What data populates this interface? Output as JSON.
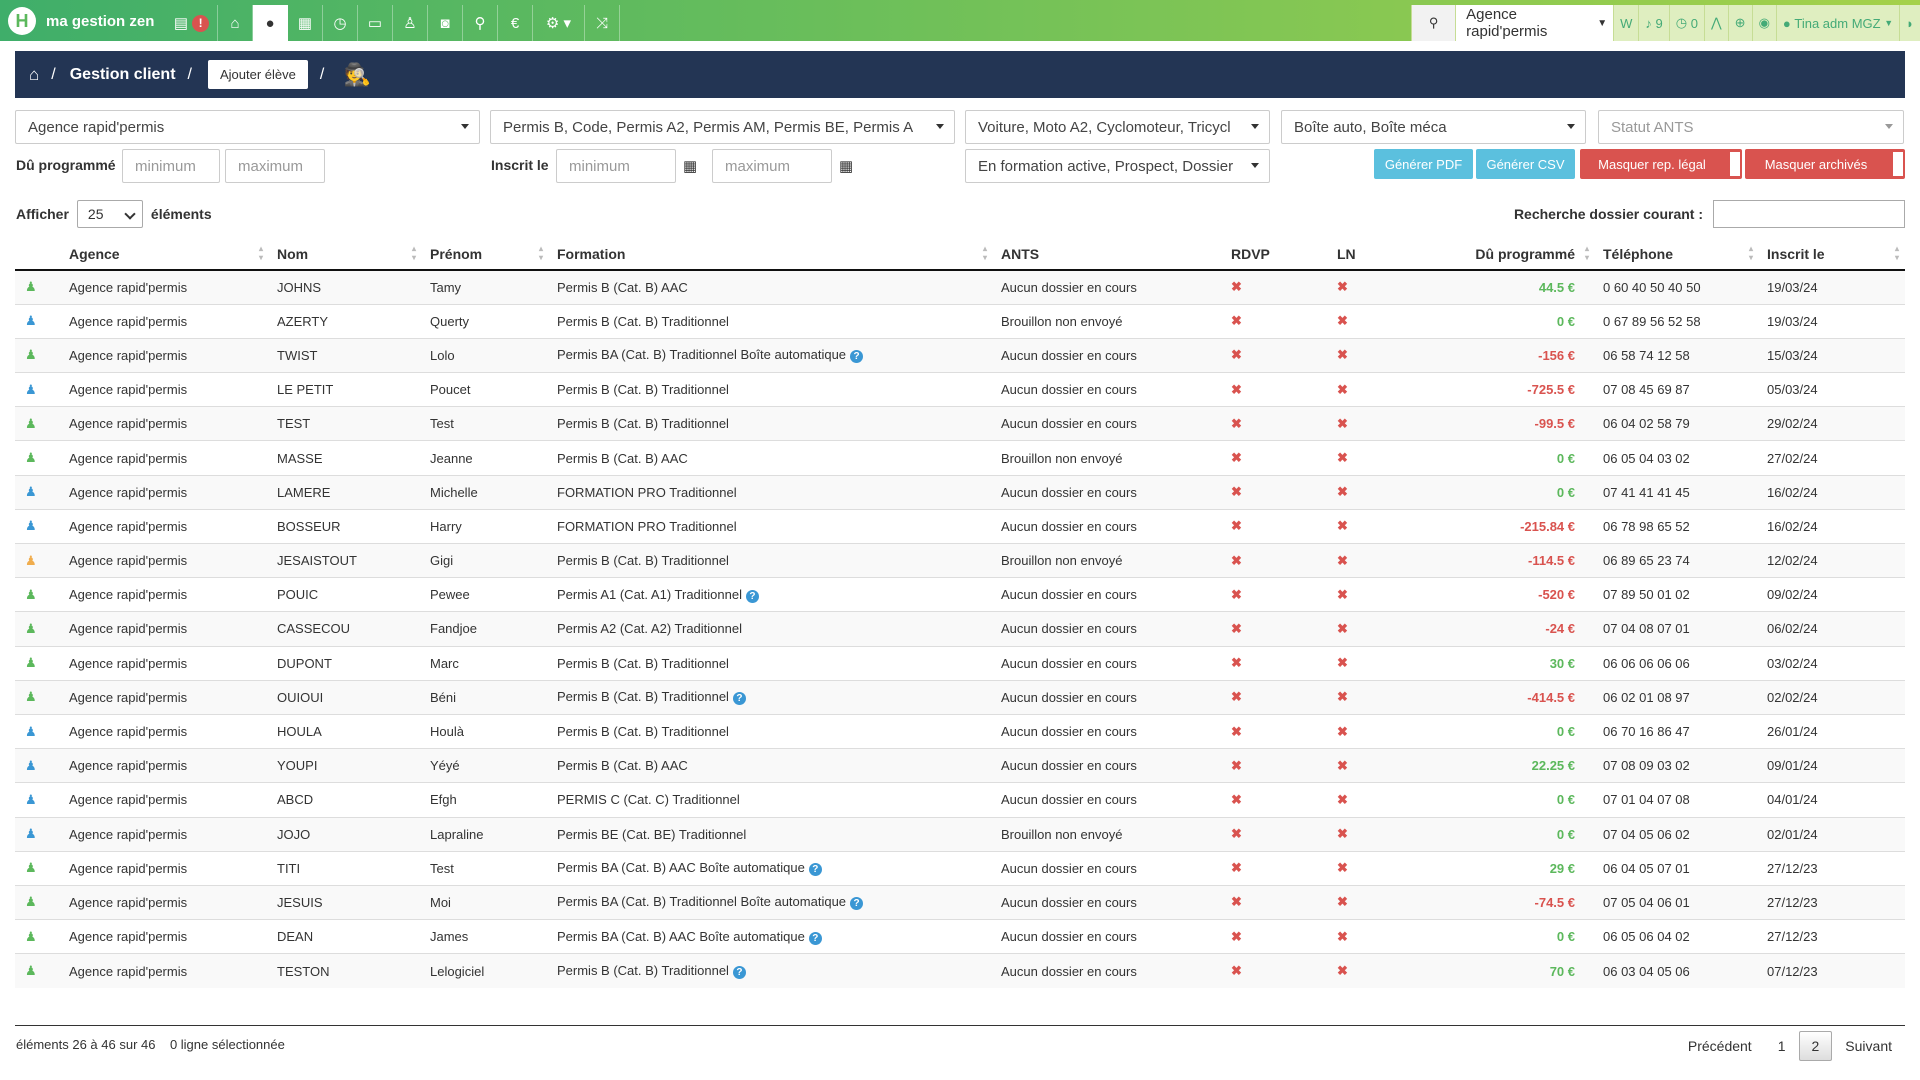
{
  "brand": {
    "name": "ma gestion zen",
    "logo_letter": "H"
  },
  "nav": {
    "alert_badge": "!",
    "icons": [
      "id-card-icon",
      "home-icon",
      "user-icon",
      "calendar-icon",
      "clock-icon",
      "credit-card-icon",
      "person-icon",
      "car-icon",
      "map-marker-icon",
      "euro-icon",
      "cogs-icon",
      "random-icon"
    ]
  },
  "topright": {
    "agency": "Agence rapid'permis",
    "w_label": "W",
    "bell_count": "9",
    "circle_count": "0",
    "user": "Tina adm MGZ"
  },
  "header": {
    "title": "Gestion client",
    "add_button": "Ajouter élève"
  },
  "filters": {
    "agency": "Agence rapid'permis",
    "permits": "Permis B, Code, Permis A2, Permis AM, Permis BE, Permis A",
    "vehicles": "Voiture, Moto A2, Cyclomoteur, Tricycl",
    "gearbox": "Boîte auto, Boîte méca",
    "ants_placeholder": "Statut ANTS",
    "status": "En formation active, Prospect, Dossier",
    "due_label": "Dû programmé",
    "registered_label": "Inscrit le",
    "min_placeholder": "minimum",
    "max_placeholder": "maximum"
  },
  "buttons": {
    "pdf": "Générer PDF",
    "csv": "Générer CSV",
    "hide_legal": "Masquer rep. légal",
    "hide_archived": "Masquer archivés"
  },
  "table_controls": {
    "show_label": "Afficher",
    "page_size": "25",
    "elements_label": "éléments",
    "search_label": "Recherche dossier courant :"
  },
  "columns": [
    "Agence",
    "Nom",
    "Prénom",
    "Formation",
    "ANTS",
    "RDVP",
    "LN",
    "Dû programmé",
    "Téléphone",
    "Inscrit le"
  ],
  "rows": [
    {
      "c": "#5cb85c",
      "agence": "Agence rapid'permis",
      "nom": "JOHNS",
      "prenom": "Tamy",
      "formation": "Permis B (Cat. B) AAC",
      "q": false,
      "ants": "Aucun dossier en cours",
      "rdvp": "✖",
      "ln": "✖",
      "du": "44.5 €",
      "neg": false,
      "tel": "0 60 40 50 40 50",
      "date": "19/03/24"
    },
    {
      "c": "#3a97d4",
      "agence": "Agence rapid'permis",
      "nom": "AZERTY",
      "prenom": "Querty",
      "formation": "Permis B (Cat. B) Traditionnel",
      "q": false,
      "ants": "Brouillon non envoyé",
      "rdvp": "✖",
      "ln": "✖",
      "du": "0 €",
      "neg": false,
      "tel": "0 67 89 56 52 58",
      "date": "19/03/24"
    },
    {
      "c": "#5cb85c",
      "agence": "Agence rapid'permis",
      "nom": "TWIST",
      "prenom": "Lolo",
      "formation": "Permis BA (Cat. B) Traditionnel Boîte automatique",
      "q": true,
      "ants": "Aucun dossier en cours",
      "rdvp": "✖",
      "ln": "✖",
      "du": "-156 €",
      "neg": true,
      "tel": "06 58 74 12 58",
      "date": "15/03/24"
    },
    {
      "c": "#3a97d4",
      "agence": "Agence rapid'permis",
      "nom": "LE PETIT",
      "prenom": "Poucet",
      "formation": "Permis B (Cat. B) Traditionnel",
      "q": false,
      "ants": "Aucun dossier en cours",
      "rdvp": "✖",
      "ln": "✖",
      "du": "-725.5 €",
      "neg": true,
      "tel": "07 08 45 69 87",
      "date": "05/03/24"
    },
    {
      "c": "#5cb85c",
      "agence": "Agence rapid'permis",
      "nom": "TEST",
      "prenom": "Test",
      "formation": "Permis B (Cat. B) Traditionnel",
      "q": false,
      "ants": "Aucun dossier en cours",
      "rdvp": "✖",
      "ln": "✖",
      "du": "-99.5 €",
      "neg": true,
      "tel": "06 04 02 58 79",
      "date": "29/02/24"
    },
    {
      "c": "#5cb85c",
      "agence": "Agence rapid'permis",
      "nom": "MASSE",
      "prenom": "Jeanne",
      "formation": "Permis B (Cat. B) AAC",
      "q": false,
      "ants": "Brouillon non envoyé",
      "rdvp": "✖",
      "ln": "✖",
      "du": "0 €",
      "neg": false,
      "tel": "06 05 04 03 02",
      "date": "27/02/24"
    },
    {
      "c": "#3a97d4",
      "agence": "Agence rapid'permis",
      "nom": "LAMERE",
      "prenom": "Michelle",
      "formation": "FORMATION PRO Traditionnel",
      "q": false,
      "ants": "Aucun dossier en cours",
      "rdvp": "✖",
      "ln": "✖",
      "du": "0 €",
      "neg": false,
      "tel": "07 41 41 41 45",
      "date": "16/02/24"
    },
    {
      "c": "#3a97d4",
      "agence": "Agence rapid'permis",
      "nom": "BOSSEUR",
      "prenom": "Harry",
      "formation": "FORMATION PRO Traditionnel",
      "q": false,
      "ants": "Aucun dossier en cours",
      "rdvp": "✖",
      "ln": "✖",
      "du": "-215.84 €",
      "neg": true,
      "tel": "06 78 98 65 52",
      "date": "16/02/24"
    },
    {
      "c": "#f0ad4e",
      "agence": "Agence rapid'permis",
      "nom": "JESAISTOUT",
      "prenom": "Gigi",
      "formation": "Permis B (Cat. B) Traditionnel",
      "q": false,
      "ants": "Brouillon non envoyé",
      "rdvp": "✖",
      "ln": "✖",
      "du": "-114.5 €",
      "neg": true,
      "tel": "06 89 65 23 74",
      "date": "12/02/24"
    },
    {
      "c": "#5cb85c",
      "agence": "Agence rapid'permis",
      "nom": "POUIC",
      "prenom": "Pewee",
      "formation": "Permis A1 (Cat. A1) Traditionnel",
      "q": true,
      "ants": "Aucun dossier en cours",
      "rdvp": "✖",
      "ln": "✖",
      "du": "-520 €",
      "neg": true,
      "tel": "07 89 50 01 02",
      "date": "09/02/24"
    },
    {
      "c": "#5cb85c",
      "agence": "Agence rapid'permis",
      "nom": "CASSECOU",
      "prenom": "Fandjoe",
      "formation": "Permis A2 (Cat. A2) Traditionnel",
      "q": false,
      "ants": "Aucun dossier en cours",
      "rdvp": "✖",
      "ln": "✖",
      "du": "-24 €",
      "neg": true,
      "tel": "07 04 08 07 01",
      "date": "06/02/24"
    },
    {
      "c": "#5cb85c",
      "agence": "Agence rapid'permis",
      "nom": "DUPONT",
      "prenom": "Marc",
      "formation": "Permis B (Cat. B) Traditionnel",
      "q": false,
      "ants": "Aucun dossier en cours",
      "rdvp": "✖",
      "ln": "✖",
      "du": "30 €",
      "neg": false,
      "tel": "06 06 06 06 06",
      "date": "03/02/24"
    },
    {
      "c": "#5cb85c",
      "agence": "Agence rapid'permis",
      "nom": "OUIOUI",
      "prenom": "Béni",
      "formation": "Permis B (Cat. B) Traditionnel",
      "q": true,
      "ants": "Aucun dossier en cours",
      "rdvp": "✖",
      "ln": "✖",
      "du": "-414.5 €",
      "neg": true,
      "tel": "06 02 01 08 97",
      "date": "02/02/24"
    },
    {
      "c": "#3a97d4",
      "agence": "Agence rapid'permis",
      "nom": "HOULA",
      "prenom": "Houlà",
      "formation": "Permis B (Cat. B) Traditionnel",
      "q": false,
      "ants": "Aucun dossier en cours",
      "rdvp": "✖",
      "ln": "✖",
      "du": "0 €",
      "neg": false,
      "tel": "06 70 16 86 47",
      "date": "26/01/24"
    },
    {
      "c": "#3a97d4",
      "agence": "Agence rapid'permis",
      "nom": "YOUPI",
      "prenom": "Yéyé",
      "formation": "Permis B (Cat. B) AAC",
      "q": false,
      "ants": "Aucun dossier en cours",
      "rdvp": "✖",
      "ln": "✖",
      "du": "22.25 €",
      "neg": false,
      "tel": "07 08 09 03 02",
      "date": "09/01/24"
    },
    {
      "c": "#3a97d4",
      "agence": "Agence rapid'permis",
      "nom": "ABCD",
      "prenom": "Efgh",
      "formation": "PERMIS C (Cat. C) Traditionnel",
      "q": false,
      "ants": "Aucun dossier en cours",
      "rdvp": "✖",
      "ln": "✖",
      "du": "0 €",
      "neg": false,
      "tel": "07 01 04 07 08",
      "date": "04/01/24"
    },
    {
      "c": "#3a97d4",
      "agence": "Agence rapid'permis",
      "nom": "JOJO",
      "prenom": "Lapraline",
      "formation": "Permis BE (Cat. BE) Traditionnel",
      "q": false,
      "ants": "Brouillon non envoyé",
      "rdvp": "✖",
      "ln": "✖",
      "du": "0 €",
      "neg": false,
      "tel": "07 04 05 06 02",
      "date": "02/01/24"
    },
    {
      "c": "#5cb85c",
      "agence": "Agence rapid'permis",
      "nom": "TITI",
      "prenom": "Test",
      "formation": "Permis BA (Cat. B) AAC Boîte automatique",
      "q": true,
      "ants": "Aucun dossier en cours",
      "rdvp": "✖",
      "ln": "✖",
      "du": "29 €",
      "neg": false,
      "tel": "06 04 05 07 01",
      "date": "27/12/23"
    },
    {
      "c": "#5cb85c",
      "agence": "Agence rapid'permis",
      "nom": "JESUIS",
      "prenom": "Moi",
      "formation": "Permis BA (Cat. B) Traditionnel Boîte automatique",
      "q": true,
      "ants": "Aucun dossier en cours",
      "rdvp": "✖",
      "ln": "✖",
      "du": "-74.5 €",
      "neg": true,
      "tel": "07 05 04 06 01",
      "date": "27/12/23"
    },
    {
      "c": "#5cb85c",
      "agence": "Agence rapid'permis",
      "nom": "DEAN",
      "prenom": "James",
      "formation": "Permis BA (Cat. B) AAC Boîte automatique",
      "q": true,
      "ants": "Aucun dossier en cours",
      "rdvp": "✖",
      "ln": "✖",
      "du": "0 €",
      "neg": false,
      "tel": "06 05 06 04 02",
      "date": "27/12/23"
    },
    {
      "c": "#5cb85c",
      "agence": "Agence rapid'permis",
      "nom": "TESTON",
      "prenom": "Lelogiciel",
      "formation": "Permis B (Cat. B) Traditionnel",
      "q": true,
      "ants": "Aucun dossier en cours",
      "rdvp": "✖",
      "ln": "✖",
      "du": "70 €",
      "neg": false,
      "tel": "06 03 04 05 06",
      "date": "07/12/23"
    }
  ],
  "footer": {
    "info": "éléments 26 à 46 sur 46",
    "selected": "0 ligne sélectionnée",
    "prev": "Précédent",
    "pages": [
      "1",
      "2"
    ],
    "next": "Suivant"
  }
}
